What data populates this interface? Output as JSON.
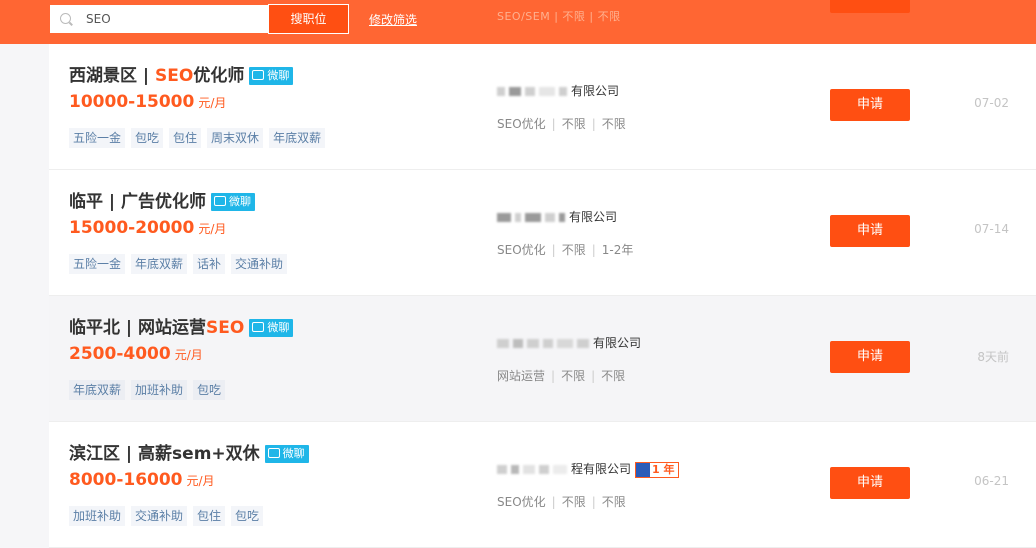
{
  "search": {
    "value": "SEO",
    "button_label": "搜职位",
    "filter_link": "修改筛选"
  },
  "ghost_row": {
    "meta": "SEO/SEM | 不限 | 不限"
  },
  "jobs": [
    {
      "title_before": "西湖景区 | ",
      "title_highlight": "SEO",
      "title_after": "优化师",
      "chat_label": "微聊",
      "salary": "10000-15000",
      "unit": "元/月",
      "tags": [
        "五险一金",
        "包吃",
        "包住",
        "周末双休",
        "年底双薪"
      ],
      "company": "有限公司",
      "category": "SEO优化",
      "education": "不限",
      "experience": "不限",
      "apply_label": "申请",
      "date": "07-02"
    },
    {
      "title_before": "临平 | 广告优化师",
      "title_highlight": "",
      "title_after": "",
      "chat_label": "微聊",
      "salary": "15000-20000",
      "unit": "元/月",
      "tags": [
        "五险一金",
        "年底双薪",
        "话补",
        "交通补助"
      ],
      "company": "有限公司",
      "category": "SEO优化",
      "education": "不限",
      "experience": "1-2年",
      "apply_label": "申请",
      "date": "07-14"
    },
    {
      "title_before": "临平北 | 网站运营",
      "title_highlight": "SEO",
      "title_after": "",
      "chat_label": "微聊",
      "salary": "2500-4000",
      "unit": "元/月",
      "tags": [
        "年底双薪",
        "加班补助",
        "包吃"
      ],
      "company": "有限公司",
      "category": "网站运营",
      "education": "不限",
      "experience": "不限",
      "apply_label": "申请",
      "date": "8天前"
    },
    {
      "title_before": "滨江区 | 高薪sem+双休",
      "title_highlight": "",
      "title_after": "",
      "chat_label": "微聊",
      "salary": "8000-16000",
      "unit": "元/月",
      "tags": [
        "加班补助",
        "交通补助",
        "包住",
        "包吃"
      ],
      "company": "程有限公司",
      "year_badge": "1 年",
      "category": "SEO优化",
      "education": "不限",
      "experience": "不限",
      "apply_label": "申请",
      "date": "06-21"
    }
  ]
}
